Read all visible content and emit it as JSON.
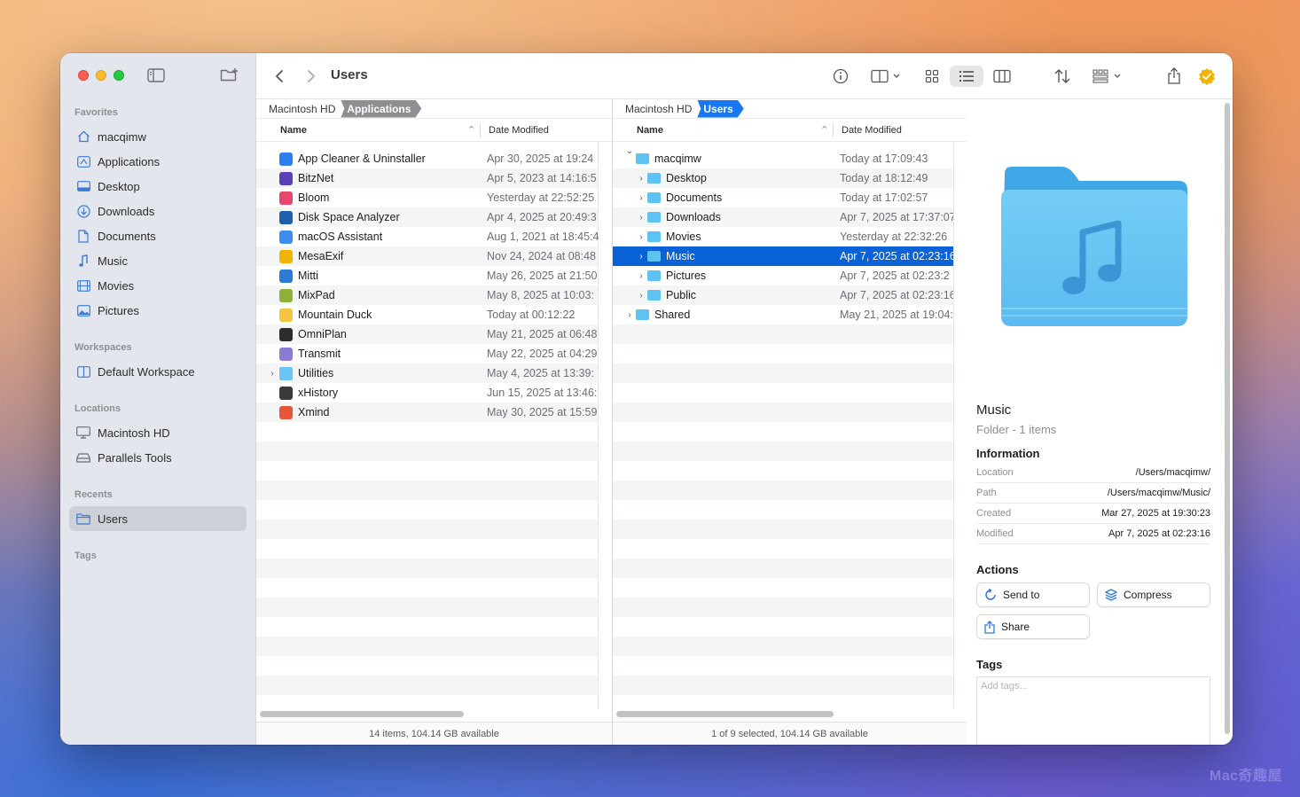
{
  "sidebar": {
    "sections": {
      "favorites": "Favorites",
      "workspaces": "Workspaces",
      "locations": "Locations",
      "recents": "Recents",
      "tags": "Tags"
    },
    "favorites": [
      {
        "label": "macqimw",
        "icon": "home-icon"
      },
      {
        "label": "Applications",
        "icon": "applications-icon"
      },
      {
        "label": "Desktop",
        "icon": "desktop-icon"
      },
      {
        "label": "Downloads",
        "icon": "downloads-icon"
      },
      {
        "label": "Documents",
        "icon": "document-icon"
      },
      {
        "label": "Music",
        "icon": "music-note-icon"
      },
      {
        "label": "Movies",
        "icon": "film-icon"
      },
      {
        "label": "Pictures",
        "icon": "photo-icon"
      }
    ],
    "workspaces": [
      {
        "label": "Default Workspace",
        "icon": "workspace-icon"
      }
    ],
    "locations": [
      {
        "label": "Macintosh HD",
        "icon": "hard-drive-icon"
      },
      {
        "label": "Parallels Tools",
        "icon": "external-drive-icon"
      }
    ],
    "recents": [
      {
        "label": "Users",
        "icon": "folder-icon",
        "active": true
      }
    ]
  },
  "toolbar": {
    "title": "Users"
  },
  "left_pane": {
    "path": [
      "Macintosh HD",
      "Applications"
    ],
    "path_active_color": "#8e8e93",
    "columns": {
      "name": "Name",
      "date": "Date Modified"
    },
    "rows": [
      {
        "name": "App Cleaner & Uninstaller",
        "date": "Apr 30, 2025 at 19:24",
        "icon_color": "#2d7ff0"
      },
      {
        "name": "BitzNet",
        "date": "Apr 5, 2023 at 14:16:5",
        "icon_color": "#5b3fb8"
      },
      {
        "name": "Bloom",
        "date": "Yesterday at 22:52:25",
        "icon_color": "#e8456d"
      },
      {
        "name": "Disk Space Analyzer",
        "date": "Apr 4, 2025 at 20:49:3",
        "icon_color": "#1f5fb0"
      },
      {
        "name": "macOS Assistant",
        "date": "Aug 1, 2021 at 18:45:4",
        "icon_color": "#3d8ef0"
      },
      {
        "name": "MesaExif",
        "date": "Nov 24, 2024 at 08:48",
        "icon_color": "#f0b400"
      },
      {
        "name": "Mitti",
        "date": "May 26, 2025 at 21:50",
        "icon_color": "#2a7ad6"
      },
      {
        "name": "MixPad",
        "date": "May 8, 2025 at 10:03:",
        "icon_color": "#8fb13a"
      },
      {
        "name": "Mountain Duck",
        "date": "Today at 00:12:22",
        "icon_color": "#f5c542"
      },
      {
        "name": "OmniPlan",
        "date": "May 21, 2025 at 06:48",
        "icon_color": "#2c2c2e"
      },
      {
        "name": "Transmit",
        "date": "May 22, 2025 at 04:29",
        "icon_color": "#8c7bd6"
      },
      {
        "name": "Utilities",
        "date": "May 4, 2025 at 13:39:",
        "icon_color": "#6ac4f5",
        "folder": true
      },
      {
        "name": "xHistory",
        "date": "Jun 15, 2025 at 13:46:",
        "icon_color": "#3a3a3c"
      },
      {
        "name": "Xmind",
        "date": "May 30, 2025 at 15:59",
        "icon_color": "#e8563a"
      }
    ],
    "status": "14 items, 104.14 GB available"
  },
  "right_pane": {
    "path": [
      "Macintosh HD",
      "Users"
    ],
    "path_active_color": "#1877f2",
    "columns": {
      "name": "Name",
      "date": "Date Modified"
    },
    "rows": [
      {
        "name": "macqimw",
        "date": "Today at 17:09:43",
        "level": 0,
        "expanded": true
      },
      {
        "name": "Desktop",
        "date": "Today at 18:12:49",
        "level": 1
      },
      {
        "name": "Documents",
        "date": "Today at 17:02:57",
        "level": 1
      },
      {
        "name": "Downloads",
        "date": "Apr 7, 2025 at 17:37:07",
        "level": 1
      },
      {
        "name": "Movies",
        "date": "Yesterday at 22:32:26",
        "level": 1
      },
      {
        "name": "Music",
        "date": "Apr 7, 2025 at 02:23:16",
        "level": 1,
        "selected": true
      },
      {
        "name": "Pictures",
        "date": "Apr 7, 2025 at 02:23:2",
        "level": 1
      },
      {
        "name": "Public",
        "date": "Apr 7, 2025 at 02:23:16",
        "level": 1
      },
      {
        "name": "Shared",
        "date": "May 21, 2025 at 19:04:",
        "level": 0
      }
    ],
    "status": "1 of 9 selected, 104.14 GB available"
  },
  "inspector": {
    "name": "Music",
    "kind": "Folder - 1 items",
    "information_heading": "Information",
    "info": [
      {
        "key": "Location",
        "value": "/Users/macqimw/"
      },
      {
        "key": "Path",
        "value": "/Users/macqimw/Music/"
      },
      {
        "key": "Created",
        "value": "Mar 27, 2025 at 19:30:23"
      },
      {
        "key": "Modified",
        "value": "Apr 7, 2025 at 02:23:16"
      }
    ],
    "actions_heading": "Actions",
    "actions": {
      "send_to": "Send to",
      "compress": "Compress",
      "share": "Share"
    },
    "tags_heading": "Tags",
    "tags_placeholder": "Add tags..."
  },
  "watermark": "Mac奇趣屋",
  "colors": {
    "accent": "#0a63d6",
    "folder": "#5ec2f2"
  }
}
